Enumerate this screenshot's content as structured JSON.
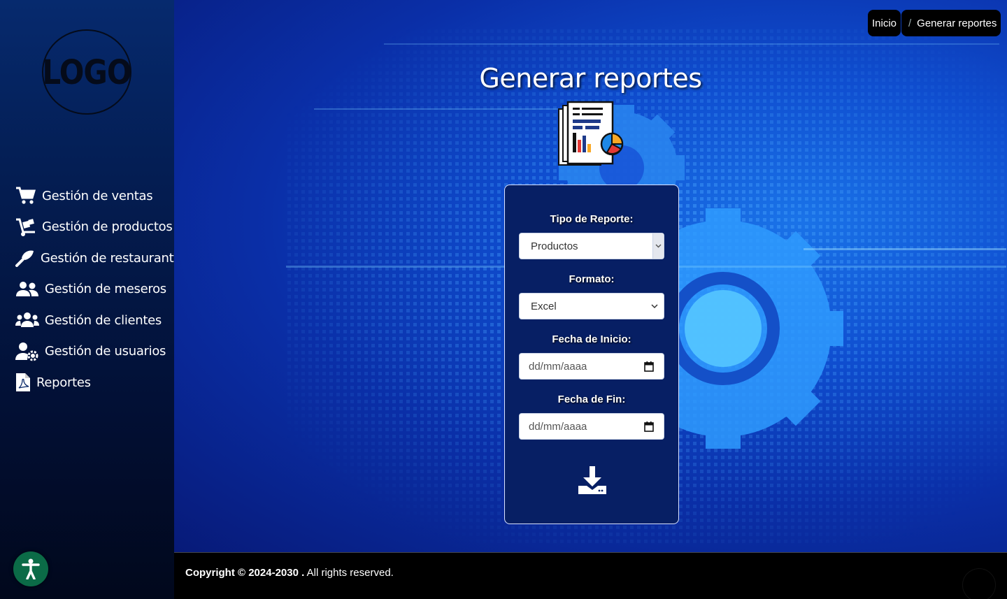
{
  "sidebar": {
    "logo_text": "LOGO",
    "items": [
      {
        "label": "Gestión de ventas",
        "icon": "cart-icon"
      },
      {
        "label": "Gestión de productos",
        "icon": "hand-truck-icon"
      },
      {
        "label": "Gestión de restaurante",
        "icon": "spatula-icon"
      },
      {
        "label": "Gestión de meseros",
        "icon": "users-icon"
      },
      {
        "label": "Gestión de clientes",
        "icon": "group-icon"
      },
      {
        "label": "Gestión de usuarios",
        "icon": "user-gear-icon"
      },
      {
        "label": "Reportes",
        "icon": "pdf-file-icon"
      }
    ],
    "accessibility_icon": "accessibility-icon"
  },
  "breadcrumb": {
    "items": [
      "Inicio",
      "Generar reportes"
    ],
    "separator": "/"
  },
  "page": {
    "title": "Generar reportes",
    "header_icon": "report-document-icon"
  },
  "form": {
    "tipo_label": "Tipo de Reporte:",
    "tipo_value": "Productos",
    "formato_label": "Formato:",
    "formato_value": "Excel",
    "inicio_label": "Fecha de Inicio:",
    "inicio_placeholder": "dd/mm/aaaa",
    "fin_label": "Fecha de Fin:",
    "fin_placeholder": "dd/mm/aaaa",
    "download_icon": "download-icon"
  },
  "footer": {
    "copyright_bold": "Copyright © 2024-2030 .",
    "copyright_rest": " All rights reserved."
  },
  "colors": {
    "sidebar_top": "#062a6e",
    "main_bg": "#0f4ed0",
    "card_bg": "#071f64",
    "access_btn": "#0b6b47"
  }
}
